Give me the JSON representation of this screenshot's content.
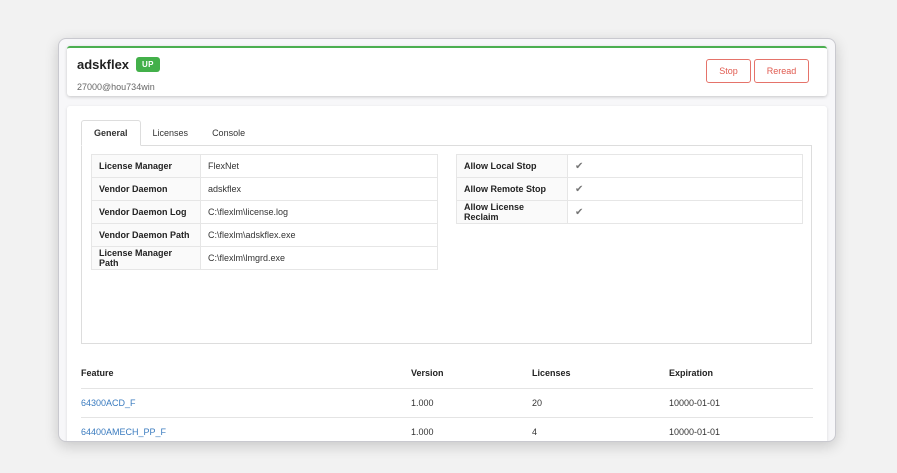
{
  "header": {
    "name": "adskflex",
    "status": "UP",
    "host": "27000@hou734win",
    "stop_label": "Stop",
    "reread_label": "Reread",
    "status_color": "#43b04a",
    "accent_color": "#e05a4f"
  },
  "tabs": [
    {
      "label": "General",
      "active": true
    },
    {
      "label": "Licenses",
      "active": false
    },
    {
      "label": "Console",
      "active": false
    }
  ],
  "general": {
    "left": [
      {
        "key": "License Manager",
        "value": "FlexNet"
      },
      {
        "key": "Vendor Daemon",
        "value": "adskflex"
      },
      {
        "key": "Vendor Daemon Log",
        "value": "C:\\flexlm\\license.log"
      },
      {
        "key": "Vendor Daemon Path",
        "value": "C:\\flexlm\\adskflex.exe"
      },
      {
        "key": "License Manager Path",
        "value": "C:\\flexlm\\lmgrd.exe"
      }
    ],
    "right": [
      {
        "key": "Allow Local Stop",
        "checked": true,
        "mark": "✔"
      },
      {
        "key": "Allow Remote Stop",
        "checked": true,
        "mark": "✔"
      },
      {
        "key": "Allow License Reclaim",
        "checked": true,
        "mark": "✔"
      }
    ]
  },
  "features": {
    "columns": [
      "Feature",
      "Version",
      "Licenses",
      "Expiration"
    ],
    "rows": [
      {
        "feature": "64300ACD_F",
        "version": "1.000",
        "licenses": "20",
        "expiration": "10000-01-01"
      },
      {
        "feature": "64400AMECH_PP_F",
        "version": "1.000",
        "licenses": "4",
        "expiration": "10000-01-01"
      }
    ]
  }
}
